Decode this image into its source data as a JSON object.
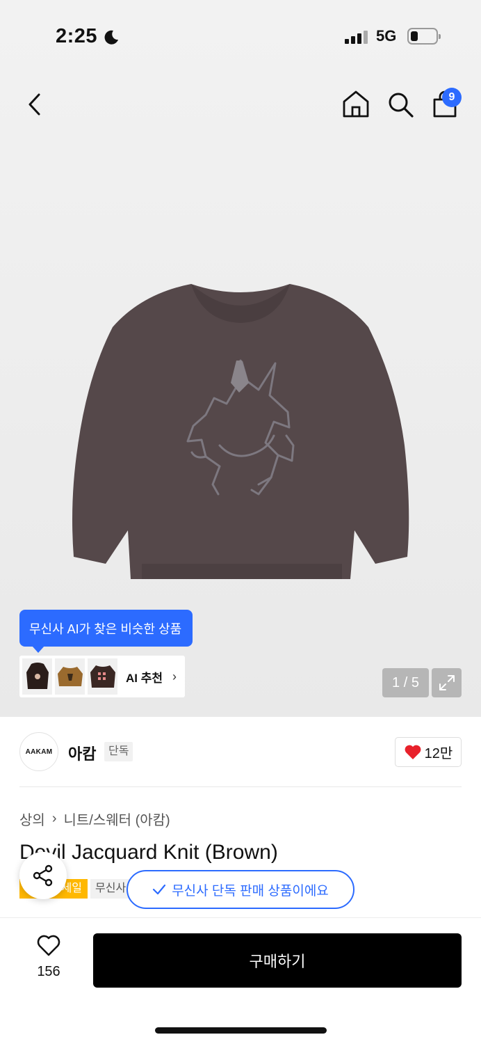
{
  "status_bar": {
    "time": "2:25",
    "network": "5G"
  },
  "nav": {
    "cart_count": "9"
  },
  "gallery": {
    "pager": "1 / 5",
    "ai_tooltip": "무신사 AI가 찾은 비슷한 상품",
    "ai_label": "AI 추천",
    "ai_chevron": "›"
  },
  "brand": {
    "logo_text": "AAKAM",
    "name": "아캄",
    "tag": "단독",
    "likes": "12만",
    "heart_color": "#e8212b"
  },
  "product": {
    "breadcrumb": [
      "상의",
      "니트/스웨터 (아캄)"
    ],
    "breadcrumb_sep": "›",
    "title": "Devil Jacquard Knit (Brown)",
    "badges": [
      "세일",
      "무신사"
    ],
    "exclusive_toast": "무신사 단독 판매 상품이에요"
  },
  "bottom_bar": {
    "wish_count": "156",
    "buy_label": "구매하기"
  },
  "colors": {
    "accent": "#2c6bff",
    "sale": "#ffb800",
    "sweater": "#55484a"
  }
}
